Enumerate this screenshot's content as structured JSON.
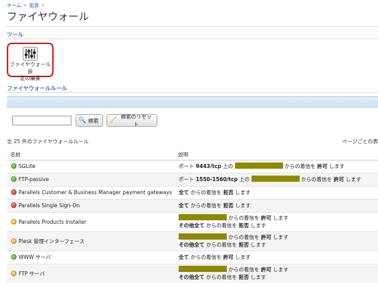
{
  "breadcrumb": {
    "home": "ホーム",
    "sep": ">",
    "ext": "拡張"
  },
  "page_title": "ファイヤウォール",
  "tools": {
    "heading": "ツール",
    "edit_label_1": "ファイヤウォール 設",
    "edit_label_2": "定の編集",
    "icon": "sliders-icon"
  },
  "rules_heading": "ファイヤウォールルール",
  "search": {
    "value": "",
    "placeholder": "",
    "search_label": "検索",
    "reset_label": "検索のリセット"
  },
  "summary": {
    "count_text": "全 25 件のファイヤウォールルール",
    "per_page_text": "ページごとの表"
  },
  "table": {
    "headers": {
      "name": "名前",
      "desc": "説明"
    },
    "colors": {
      "allow": "#3b9a1f",
      "deny": "#c61d0f",
      "partial": "#e09a0f",
      "redaction": "#8b8a00"
    },
    "rows": [
      {
        "status": "green",
        "name": "SGLite",
        "p1": "ポート ",
        "b1": "9443/tcp",
        "p2": " 上の ",
        "p3": " からの着信を ",
        "b2": "許可",
        "p4": " します"
      },
      {
        "status": "green",
        "name": "FTP-passive",
        "p1": "ポート ",
        "b1": "1550-1560/tcp",
        "p2": " 上の ",
        "p3": " からの着信を ",
        "b2": "許可",
        "p4": " します"
      },
      {
        "status": "red",
        "name": "Parallels Customer & Business Manager payment gateways",
        "b1": "全て",
        "p1": " からの着信を ",
        "b2": "拒否",
        "p2": " します"
      },
      {
        "status": "red",
        "name": "Parallels Single Sign-On",
        "b1": "全て",
        "p1": " からの着信を ",
        "b2": "拒否",
        "p2": " します"
      },
      {
        "status": "yellow",
        "name": "Parallels Products Installer",
        "p1": " からの着信を ",
        "b1": "許可",
        "p2": " します",
        "b2": "その他全て",
        "p3": " からの着信を ",
        "b3": "拒否",
        "p4": " します"
      },
      {
        "status": "yellow",
        "name": "Plesk 管理インターフェース",
        "p1": " からの着信を ",
        "b1": "許可",
        "p2": " します",
        "b2": "その他全て",
        "p3": " からの着信を ",
        "b3": "拒否",
        "p4": " します"
      },
      {
        "status": "green",
        "name": "WWW サーバ",
        "b1": "全て",
        "p1": " からの着信を ",
        "b2": "許可",
        "p2": " します"
      },
      {
        "status": "yellow",
        "name": "FTP サーバ",
        "p1": " からの着信を ",
        "b1": "許可",
        "p2": " します",
        "b2": "その他全て",
        "p3": " からの着信を ",
        "b3": "拒否",
        "p4": " します"
      }
    ]
  }
}
